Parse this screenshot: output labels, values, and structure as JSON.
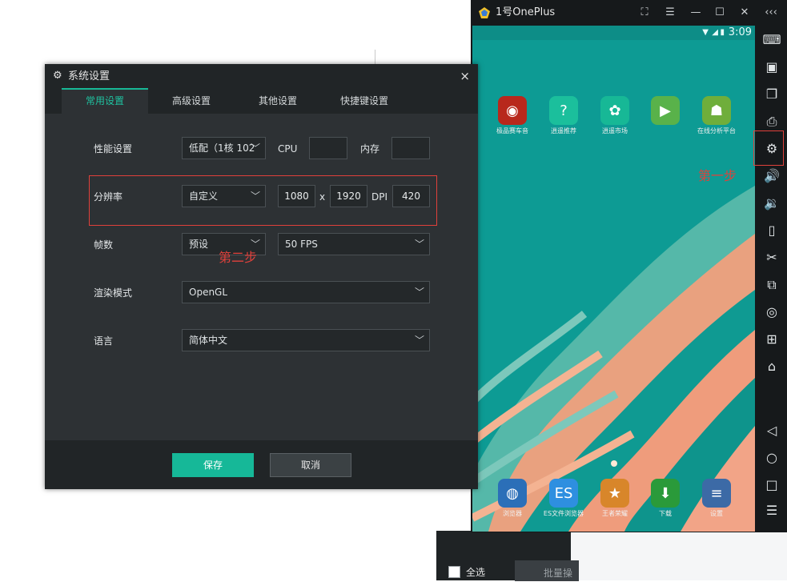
{
  "background": {
    "select_all": "全选",
    "batch": "批量操"
  },
  "emulator": {
    "title": "1号OnePlus",
    "controls": [
      "⛶",
      "☰",
      "—",
      "☐",
      "✕",
      "‹‹‹"
    ],
    "clock": "3:09",
    "apps_top": [
      {
        "label": "极品赛车音",
        "color": "#b8281c",
        "icon": "race-icon",
        "glyph": "◉"
      },
      {
        "label": "逍遥推荐",
        "color": "#1bbf9c",
        "icon": "help-icon",
        "glyph": "?"
      },
      {
        "label": "逍遥市场",
        "color": "#17b896",
        "icon": "market-icon",
        "glyph": "✿"
      },
      {
        "label": "",
        "color": "#59b24a",
        "icon": "play-icon",
        "glyph": "▶"
      },
      {
        "label": "在线分析平台",
        "color": "#6fae3b",
        "icon": "android-icon",
        "glyph": "☗"
      }
    ],
    "apps_bottom": [
      {
        "label": "浏览器",
        "color": "#2b6fb8",
        "icon": "browser-icon",
        "glyph": "◍"
      },
      {
        "label": "ES文件浏览器",
        "color": "#2e8fe0",
        "icon": "es-file-icon",
        "glyph": "ES"
      },
      {
        "label": "王者荣耀",
        "color": "#d8862a",
        "icon": "game-icon",
        "glyph": "★"
      },
      {
        "label": "下载",
        "color": "#2a9a3a",
        "icon": "download-icon",
        "glyph": "⬇"
      },
      {
        "label": "设置",
        "color": "#3c6aa6",
        "icon": "settings-app-icon",
        "glyph": "≡"
      }
    ],
    "toolbar": [
      {
        "name": "keyboard-icon",
        "glyph": "⌨"
      },
      {
        "name": "apk-install-icon",
        "glyph": "▣"
      },
      {
        "name": "multi-window-icon",
        "glyph": "❐"
      },
      {
        "name": "screenshot-icon",
        "glyph": "⎙"
      },
      {
        "name": "settings-gear-icon",
        "glyph": "⚙"
      },
      {
        "name": "volume-up-icon",
        "glyph": "🔊"
      },
      {
        "name": "volume-down-icon",
        "glyph": "🔉"
      },
      {
        "name": "shake-icon",
        "glyph": "▯"
      },
      {
        "name": "cut-icon",
        "glyph": "✂"
      },
      {
        "name": "rotate-icon",
        "glyph": "⧉"
      },
      {
        "name": "location-icon",
        "glyph": "◎"
      },
      {
        "name": "network-icon",
        "glyph": "⊞"
      },
      {
        "name": "mouse-icon",
        "glyph": "⌂"
      },
      {
        "name": "back-icon",
        "glyph": "◁"
      },
      {
        "name": "home-icon",
        "glyph": "○"
      },
      {
        "name": "recent-icon",
        "glyph": "□"
      },
      {
        "name": "menu-icon",
        "glyph": "☰"
      }
    ],
    "step1_label": "第一步"
  },
  "dialog": {
    "title": "系统设置",
    "close": "×",
    "tabs": [
      "常用设置",
      "高级设置",
      "其他设置",
      "快捷键设置"
    ],
    "performance": {
      "label": "性能设置",
      "value": "低配（1核 102",
      "cpu_label": "CPU",
      "memory_label": "内存"
    },
    "resolution": {
      "label": "分辨率",
      "value": "自定义",
      "width": "1080",
      "x": "x",
      "height": "1920",
      "dpi_label": "DPI",
      "dpi": "420"
    },
    "fps": {
      "label": "帧数",
      "preset": "预设",
      "value": "50 FPS"
    },
    "render": {
      "label": "渲染模式",
      "value": "OpenGL"
    },
    "language": {
      "label": "语言",
      "value": "简体中文"
    },
    "step2_label": "第二步",
    "save": "保存",
    "cancel": "取消"
  }
}
